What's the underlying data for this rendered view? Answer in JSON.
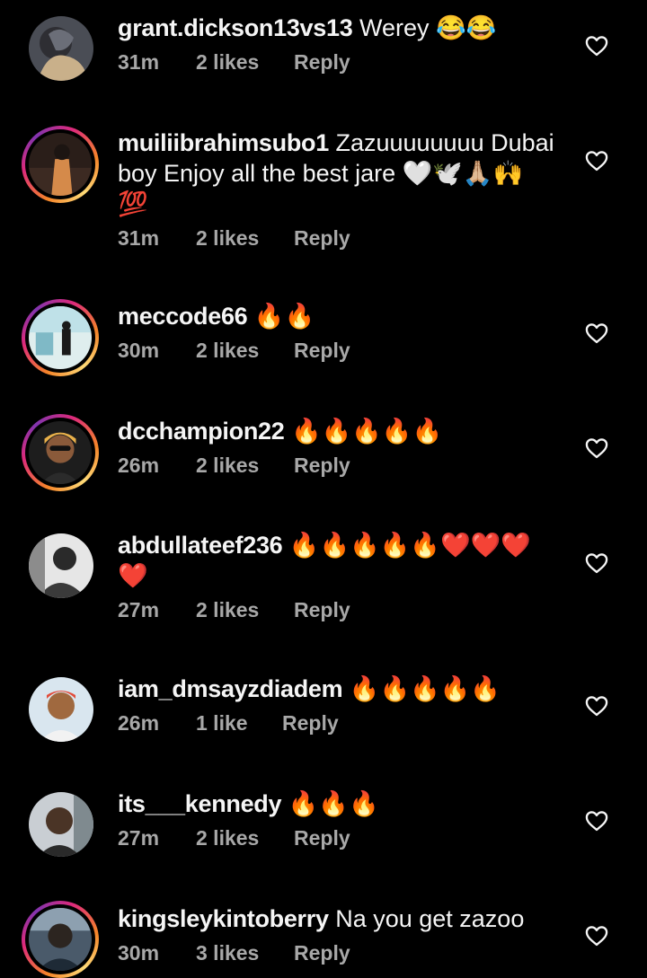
{
  "comments": [
    {
      "username": "grant.dickson13vs13",
      "text": "Werey 😂😂",
      "time": "31m",
      "likes": "2 likes",
      "reply": "Reply",
      "avatar_ring": false,
      "avatar_colors": [
        "#6b6e78",
        "#3a3a40",
        "#c9b08a"
      ]
    },
    {
      "username": "muiliibrahimsubo1",
      "text": "Zazuuuuuuuu Dubai boy Enjoy all the best jare 🤍🕊️🙏🏼🙌 💯",
      "time": "31m",
      "likes": "2 likes",
      "reply": "Reply",
      "avatar_ring": true,
      "avatar_colors": [
        "#3c2a22",
        "#d58a4a",
        "#1c1512"
      ]
    },
    {
      "username": "meccode66",
      "text": "🔥🔥",
      "time": "30m",
      "likes": "2 likes",
      "reply": "Reply",
      "avatar_ring": true,
      "avatar_colors": [
        "#bfe1e8",
        "#e8f2f2",
        "#1a1a1a"
      ]
    },
    {
      "username": "dcchampion22",
      "text": "🔥🔥🔥🔥🔥",
      "time": "26m",
      "likes": "2 likes",
      "reply": "Reply",
      "avatar_ring": true,
      "avatar_colors": [
        "#1d1d1d",
        "#8a5a3a",
        "#e8b04a"
      ]
    },
    {
      "username": "abdullateef236",
      "text": "🔥🔥🔥🔥🔥❤️❤️❤️ ❤️",
      "time": "27m",
      "likes": "2 likes",
      "reply": "Reply",
      "avatar_ring": false,
      "avatar_colors": [
        "#e6e6e6",
        "#2a2a2a",
        "#8c8c8c"
      ]
    },
    {
      "username": "iam_dmsayzdiadem",
      "text": "🔥🔥🔥🔥🔥",
      "time": "26m",
      "likes": "1 like",
      "reply": "Reply",
      "avatar_ring": false,
      "avatar_colors": [
        "#d9e6ef",
        "#a0693f",
        "#e24c3a"
      ]
    },
    {
      "username": "its___kennedy",
      "text": "🔥🔥🔥",
      "time": "27m",
      "likes": "2 likes",
      "reply": "Reply",
      "avatar_ring": false,
      "avatar_colors": [
        "#c9ced3",
        "#4a3426",
        "#7f8a8f"
      ]
    },
    {
      "username": "kingsleykintoberry",
      "text": "Na you get zazoo",
      "time": "30m",
      "likes": "3 likes",
      "reply": "Reply",
      "avatar_ring": true,
      "avatar_colors": [
        "#4a5a6a",
        "#2c2520",
        "#8da0b0"
      ]
    }
  ],
  "colors": {
    "background": "#000000",
    "primary_text": "#f5f5f5",
    "secondary_text": "#a8a8a8",
    "heart_outline": "#f5f5f5"
  },
  "icons": {
    "like": "heart-outline-icon"
  }
}
